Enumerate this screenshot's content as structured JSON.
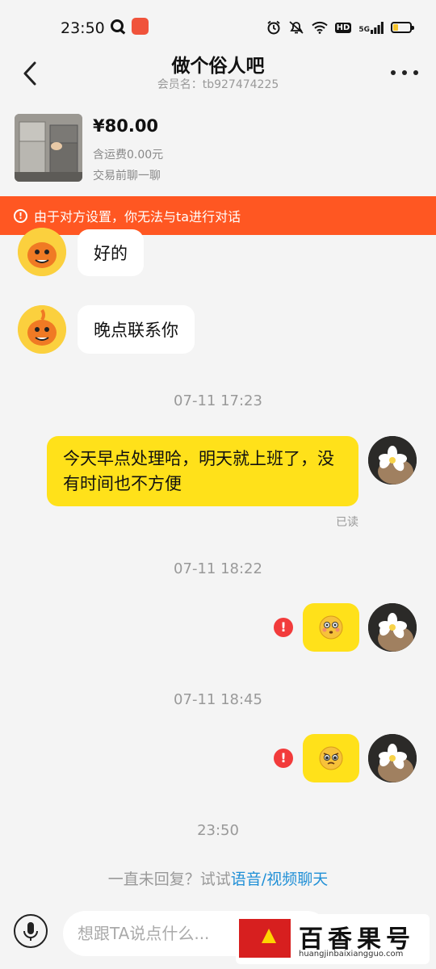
{
  "status_bar": {
    "time": "23:50",
    "app_badge": "",
    "network_label": "5G",
    "hd_label": "HD"
  },
  "header": {
    "title": "做个俗人吧",
    "member_label": "会员名：tb927474225"
  },
  "product": {
    "price": "¥80.00",
    "shipping": "含运费0.00元",
    "note": "交易前聊一聊"
  },
  "warning": {
    "icon": "!",
    "text": "由于对方设置，你无法与ta进行对话"
  },
  "messages": {
    "in_1": "好的",
    "in_2": "晚点联系你",
    "ts_1": "07-11 17:23",
    "out_1": "今天早点处理哈，明天就上班了，没有时间也不方便",
    "read_flag": "已读",
    "ts_2": "07-11 18:22",
    "ts_3": "07-11 18:45",
    "ts_4": "23:50",
    "error_icon": "!"
  },
  "hint": {
    "text": "一直未回复？试试",
    "link": "语音/视频聊天"
  },
  "input": {
    "placeholder": "想跟TA说点什么..."
  },
  "watermark": {
    "title": "百香果号",
    "url": "huangjinbaixiangguo.com"
  },
  "colors": {
    "warning_bg": "#ff5722",
    "bubble_out": "#ffe11a",
    "link": "#1f8fd6",
    "error": "#f23b3b"
  }
}
